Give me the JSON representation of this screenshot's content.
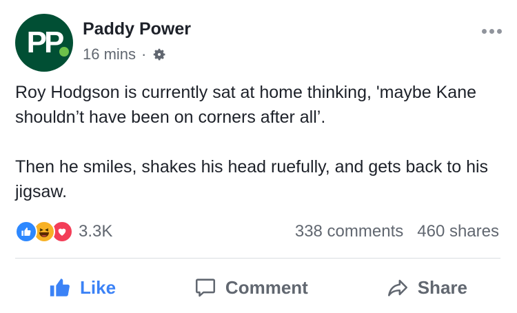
{
  "post": {
    "page_name": "Paddy Power",
    "avatar_text": "PP",
    "time": "16 mins",
    "separator": "·",
    "privacy_icon": "gear-icon",
    "more_icon": "more-options-icon",
    "text": [
      "Roy Hodgson is currently sat at home thinking, 'maybe Kane shouldn’t have been on corners after all’.",
      "Then he smiles, shakes his head ruefully, and gets back to his jigsaw."
    ],
    "reactions": {
      "icons": [
        "like-reaction-icon",
        "haha-reaction-icon",
        "love-reaction-icon"
      ],
      "count": "3.3K"
    },
    "comments_count": "338 comments",
    "shares_count": "460 shares"
  },
  "actions": {
    "like": "Like",
    "comment": "Comment",
    "share": "Share"
  },
  "colors": {
    "brand": "#014f34",
    "brand_dot": "#6cc04a",
    "like_blue": "#3b82f6",
    "muted": "#616770"
  }
}
